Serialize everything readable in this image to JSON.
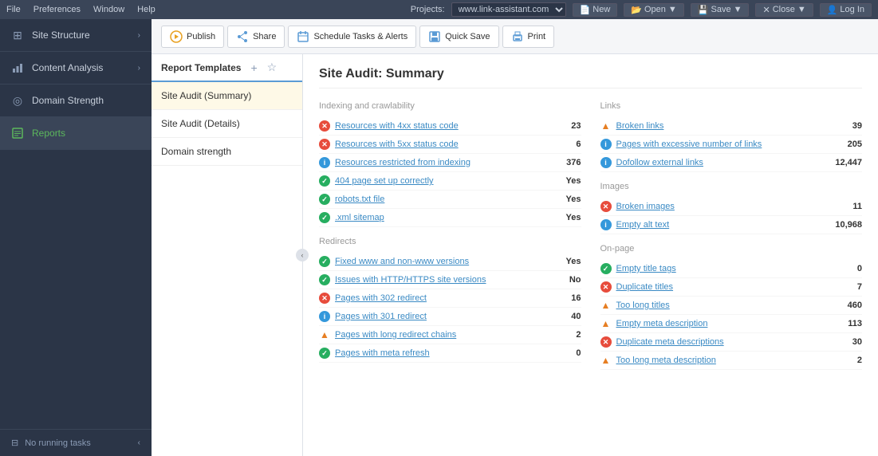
{
  "menubar": {
    "file": "File",
    "preferences": "Preferences",
    "window": "Window",
    "help": "Help",
    "projects_label": "Projects:",
    "project_url": "www.link-assistant.com",
    "new_btn": "New",
    "open_btn": "Open",
    "save_btn": "Save",
    "close_btn": "Close",
    "login_btn": "Log In"
  },
  "sidebar": {
    "items": [
      {
        "id": "site-structure",
        "label": "Site Structure",
        "icon": "⊞"
      },
      {
        "id": "content-analysis",
        "label": "Content Analysis",
        "icon": "📊"
      },
      {
        "id": "domain-strength",
        "label": "Domain Strength",
        "icon": "◎"
      },
      {
        "id": "reports",
        "label": "Reports",
        "icon": "📋",
        "active": true
      }
    ],
    "footer": {
      "label": "No running tasks"
    }
  },
  "toolbar": {
    "publish_label": "Publish",
    "share_label": "Share",
    "schedule_label": "Schedule Tasks & Alerts",
    "quicksave_label": "Quick Save",
    "print_label": "Print"
  },
  "templates": {
    "header_label": "Report Templates",
    "items": [
      {
        "id": "site-audit-summary",
        "label": "Site Audit (Summary)",
        "active": true
      },
      {
        "id": "site-audit-details",
        "label": "Site Audit (Details)",
        "active": false
      },
      {
        "id": "domain-strength",
        "label": "Domain strength",
        "active": false
      }
    ]
  },
  "report": {
    "title": "Site Audit:  Summary",
    "sections": {
      "left": [
        {
          "title": "Indexing and crawlability",
          "rows": [
            {
              "icon": "red",
              "label": "Resources with 4xx status code",
              "value": "23"
            },
            {
              "icon": "red",
              "label": "Resources with 5xx status code",
              "value": "6"
            },
            {
              "icon": "blue",
              "label": "Resources restricted from indexing",
              "value": "376"
            },
            {
              "icon": "green",
              "label": "404 page set up correctly",
              "value": "Yes"
            },
            {
              "icon": "green",
              "label": "robots.txt file",
              "value": "Yes"
            },
            {
              "icon": "green",
              "label": ".xml sitemap",
              "value": "Yes"
            }
          ]
        },
        {
          "title": "Redirects",
          "rows": [
            {
              "icon": "green",
              "label": "Fixed www and non-www versions",
              "value": "Yes"
            },
            {
              "icon": "green",
              "label": "Issues with HTTP/HTTPS site versions",
              "value": "No"
            },
            {
              "icon": "red",
              "label": "Pages with 302 redirect",
              "value": "16"
            },
            {
              "icon": "blue",
              "label": "Pages with 301 redirect",
              "value": "40"
            },
            {
              "icon": "warning",
              "label": "Pages with long redirect chains",
              "value": "2"
            },
            {
              "icon": "green",
              "label": "Pages with meta refresh",
              "value": "0"
            }
          ]
        }
      ],
      "right": [
        {
          "title": "Links",
          "rows": [
            {
              "icon": "warning",
              "label": "Broken links",
              "value": "39"
            },
            {
              "icon": "blue",
              "label": "Pages with excessive number of links",
              "value": "205"
            },
            {
              "icon": "blue",
              "label": "Dofollow external links",
              "value": "12,447"
            }
          ]
        },
        {
          "title": "Images",
          "rows": [
            {
              "icon": "red",
              "label": "Broken images",
              "value": "11"
            },
            {
              "icon": "blue",
              "label": "Empty alt text",
              "value": "10,968"
            }
          ]
        },
        {
          "title": "On-page",
          "rows": [
            {
              "icon": "green",
              "label": "Empty title tags",
              "value": "0"
            },
            {
              "icon": "red",
              "label": "Duplicate titles",
              "value": "7"
            },
            {
              "icon": "warning",
              "label": "Too long titles",
              "value": "460"
            },
            {
              "icon": "warning",
              "label": "Empty meta description",
              "value": "113"
            },
            {
              "icon": "red",
              "label": "Duplicate meta descriptions",
              "value": "30"
            },
            {
              "icon": "warning",
              "label": "Too long meta description",
              "value": "2"
            }
          ]
        }
      ]
    }
  }
}
